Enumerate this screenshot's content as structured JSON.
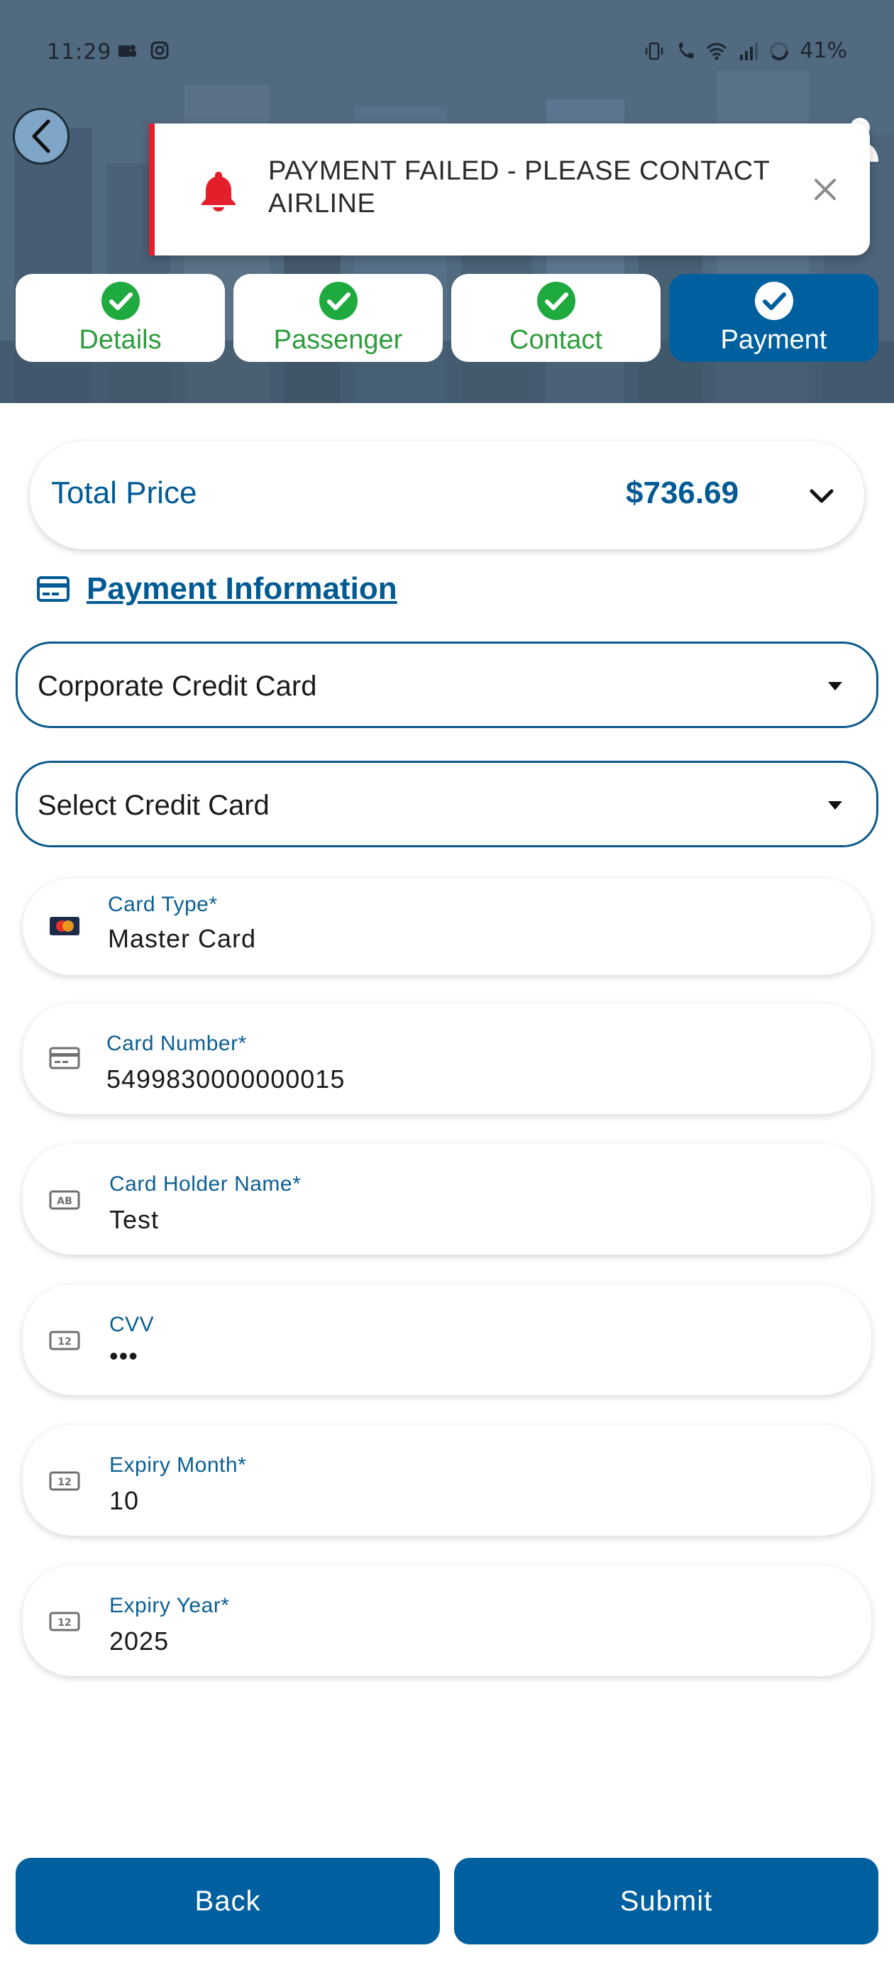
{
  "status_bar": {
    "time": "11:29",
    "battery": "41%",
    "icons": [
      "teams-icon",
      "instagram-icon",
      "vibrate-icon",
      "wifi-call-icon",
      "wifi-icon",
      "signal-icon",
      "battery-icon"
    ]
  },
  "toast": {
    "message": "PAYMENT FAILED - PLEASE CONTACT AIRLINE",
    "accent_color": "#e21f2a"
  },
  "steps": [
    {
      "label": "Details",
      "completed": true,
      "active": false
    },
    {
      "label": "Passenger",
      "completed": true,
      "active": false
    },
    {
      "label": "Contact",
      "completed": true,
      "active": false
    },
    {
      "label": "Payment",
      "completed": true,
      "active": true
    }
  ],
  "price": {
    "label": "Total Price",
    "value": "$736.69"
  },
  "payment_section": {
    "title": "Payment Information",
    "payment_method": "Corporate Credit Card",
    "credit_card_select": "Select Credit Card"
  },
  "fields": {
    "card_type": {
      "label": "Card Type*",
      "value": "Master Card",
      "icon": "mastercard-icon"
    },
    "card_number": {
      "label": "Card Number*",
      "value": "5499830000000015",
      "icon": "credit-card-icon"
    },
    "card_holder": {
      "label": "Card Holder Name*",
      "value": "Test",
      "icon": "ab-badge-icon"
    },
    "cvv": {
      "label": "CVV",
      "value": "•••",
      "icon": "numeric-badge-icon"
    },
    "expiry_month": {
      "label": "Expiry Month*",
      "value": "10",
      "icon": "numeric-badge-icon"
    },
    "expiry_year": {
      "label": "Expiry Year*",
      "value": "2025",
      "icon": "numeric-badge-icon"
    }
  },
  "buttons": {
    "back": "Back",
    "submit": "Submit"
  },
  "colors": {
    "primary": "#00609f",
    "success": "#2e9c3c",
    "error": "#e21f2a"
  }
}
